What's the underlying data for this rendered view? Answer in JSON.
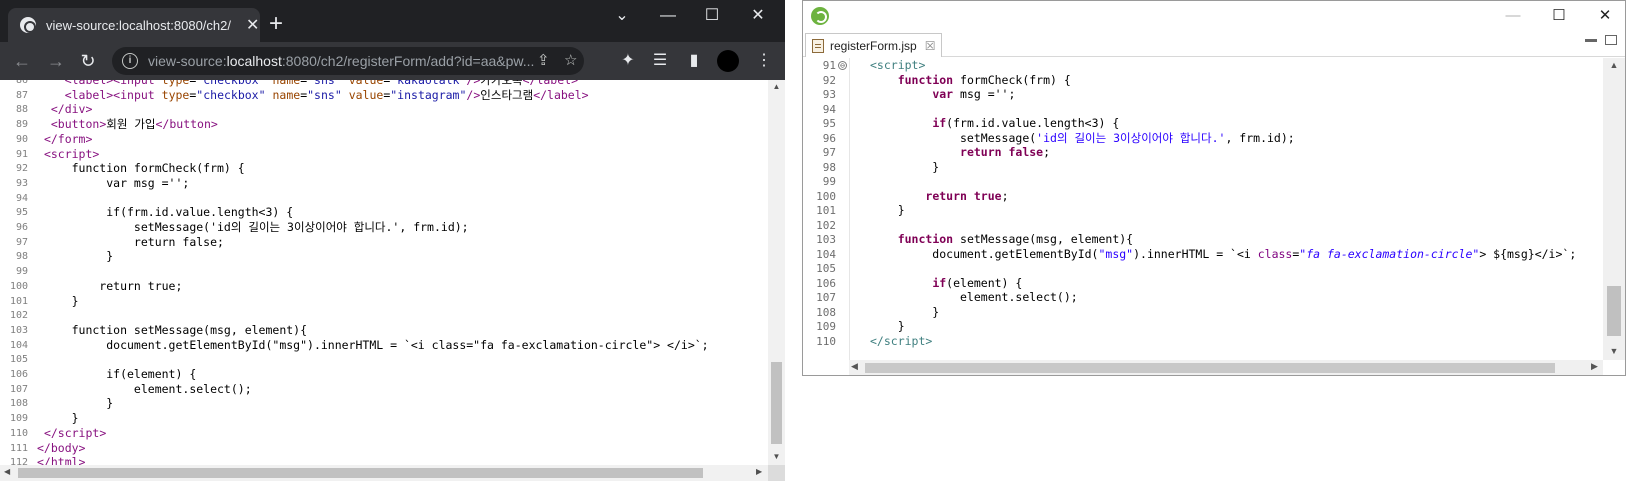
{
  "browser": {
    "tab_title": "view-source:localhost:8080/ch2/",
    "tab_close": "✕",
    "new_tab": "+",
    "url_prefix": "view-source:",
    "url_host": "localhost",
    "url_rest": ":8080/ch2/registerForm/add?id=aa&pw...",
    "icons": [
      "back-icon",
      "forward-icon",
      "reload-icon",
      "info-icon",
      "share-icon",
      "star-icon",
      "extensions-icon",
      "reading-list-icon",
      "side-panel-icon",
      "profile-avatar",
      "menu-icon"
    ]
  },
  "source_lines": [
    {
      "n": "86",
      "html": "    <span class=\"tag\">&lt;label&gt;&lt;input</span> <span class=\"attr\">type</span>=<span class=\"val\">\"checkbox\"</span> <span class=\"attr\">name</span>=<span class=\"val\">\"sns\"</span> <span class=\"attr\">value</span>=<span class=\"val\">\"kakaotalk\"</span><span class=\"tag\">/&gt;</span>카카오톡<span class=\"tag\">&lt;/label&gt;</span>"
    },
    {
      "n": "87",
      "html": "    <span class=\"tag\">&lt;label&gt;&lt;input</span> <span class=\"attr\">type</span>=<span class=\"val\">\"checkbox\"</span> <span class=\"attr\">name</span>=<span class=\"val\">\"sns\"</span> <span class=\"attr\">value</span>=<span class=\"val\">\"instagram\"</span><span class=\"tag\">/&gt;</span>인스타그램<span class=\"tag\">&lt;/label&gt;</span>"
    },
    {
      "n": "88",
      "html": "  <span class=\"tag\">&lt;/div&gt;</span>"
    },
    {
      "n": "89",
      "html": "  <span class=\"tag\">&lt;button&gt;</span>회원 가입<span class=\"tag\">&lt;/button&gt;</span>"
    },
    {
      "n": "90",
      "html": " <span class=\"tag\">&lt;/form&gt;</span>"
    },
    {
      "n": "91",
      "html": " <span class=\"tag\">&lt;script&gt;</span>"
    },
    {
      "n": "92",
      "html": "     function formCheck(frm) {"
    },
    {
      "n": "93",
      "html": "          var msg ='';"
    },
    {
      "n": "94",
      "html": ""
    },
    {
      "n": "95",
      "html": "          if(frm.id.value.length&lt;3) {"
    },
    {
      "n": "96",
      "html": "              setMessage('id의 길이는 3이상이어야 합니다.', frm.id);"
    },
    {
      "n": "97",
      "html": "              return false;"
    },
    {
      "n": "98",
      "html": "          }"
    },
    {
      "n": "99",
      "html": ""
    },
    {
      "n": "100",
      "html": "         return true;"
    },
    {
      "n": "101",
      "html": "     }"
    },
    {
      "n": "102",
      "html": ""
    },
    {
      "n": "103",
      "html": "     function setMessage(msg, element){"
    },
    {
      "n": "104",
      "html": "          document.getElementById(\"msg\").innerHTML = `&lt;i class=\"fa fa-exclamation-circle\"&gt; &lt;/i&gt;`;"
    },
    {
      "n": "105",
      "html": ""
    },
    {
      "n": "106",
      "html": "          if(element) {"
    },
    {
      "n": "107",
      "html": "              element.select();"
    },
    {
      "n": "108",
      "html": "          }"
    },
    {
      "n": "109",
      "html": "     }"
    },
    {
      "n": "110",
      "html": " <span class=\"tag\">&lt;/script&gt;</span>"
    },
    {
      "n": "111",
      "html": "<span class=\"tag\">&lt;/body&gt;</span>"
    },
    {
      "n": "112",
      "html": "<span class=\"tag\">&lt;/html&gt;</span>"
    }
  ],
  "eclipse": {
    "tab_label": "registerForm.jsp",
    "tab_close": "☒",
    "fold_symbol": "⊖",
    "lines": [
      {
        "n": "91",
        "html": "<span class=\"jtag\">&lt;script&gt;</span>"
      },
      {
        "n": "92",
        "html": "    <span class=\"kw\">function</span> formCheck(frm) {"
      },
      {
        "n": "93",
        "html": "         <span class=\"kw\">var</span> msg ='';"
      },
      {
        "n": "94",
        "html": ""
      },
      {
        "n": "95",
        "html": "         <span class=\"kw\">if</span>(frm.id.value.length&lt;3) {"
      },
      {
        "n": "96",
        "html": "             setMessage(<span class=\"str\">'id의 길이는 3이상이어야 합니다.'</span>, frm.id);"
      },
      {
        "n": "97",
        "html": "             <span class=\"kw\">return false</span>;"
      },
      {
        "n": "98",
        "html": "         }"
      },
      {
        "n": "99",
        "html": ""
      },
      {
        "n": "100",
        "html": "        <span class=\"kw\">return true</span>;"
      },
      {
        "n": "101",
        "html": "    }"
      },
      {
        "n": "102",
        "html": ""
      },
      {
        "n": "103",
        "html": "    <span class=\"kw\">function</span> setMessage(msg, element){"
      },
      {
        "n": "104",
        "html": "         document.getElementById(<span class=\"str\">\"msg\"</span>).innerHTML = `&lt;i <span class=\"jattr\">class</span>=<span class=\"jval\">\"fa fa-exclamation-circle\"</span>&gt; ${msg}&lt;/i&gt;`;"
      },
      {
        "n": "105",
        "html": ""
      },
      {
        "n": "106",
        "html": "         <span class=\"kw\">if</span>(element) {"
      },
      {
        "n": "107",
        "html": "             element.select();"
      },
      {
        "n": "108",
        "html": "         }"
      },
      {
        "n": "109",
        "html": "    }"
      },
      {
        "n": "110",
        "html": "<span class=\"jtag\">&lt;/script&gt;</span>"
      }
    ]
  }
}
